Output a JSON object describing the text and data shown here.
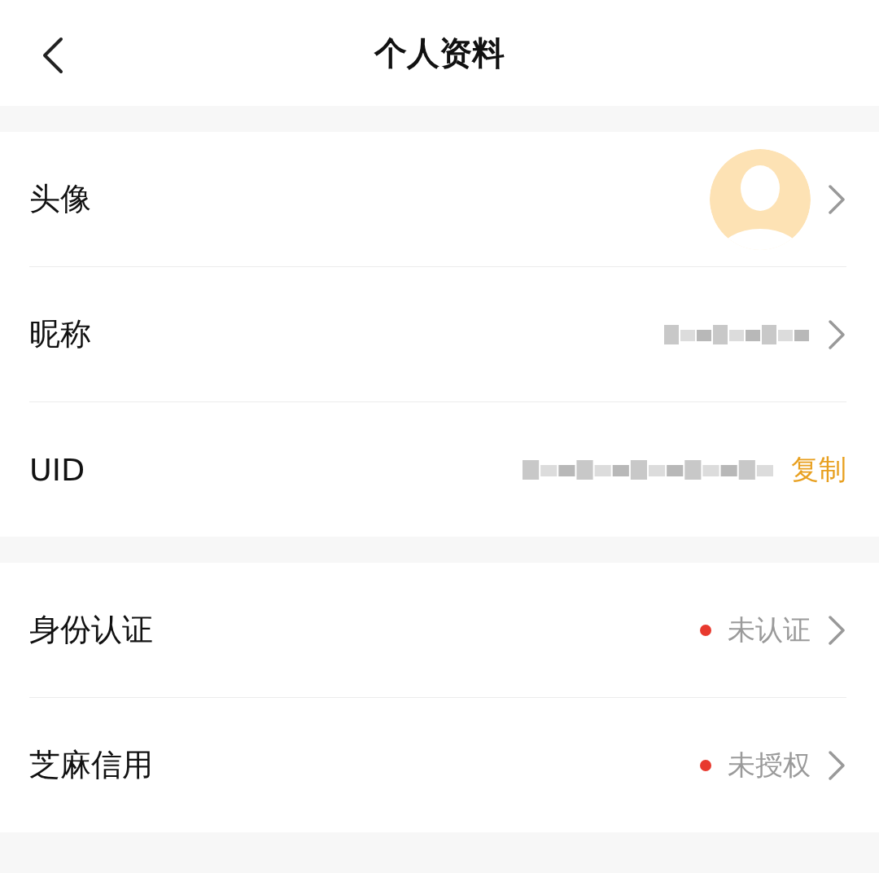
{
  "header": {
    "title": "个人资料"
  },
  "sections": [
    {
      "rows": [
        {
          "kind": "avatar",
          "label": "头像",
          "chevron": true
        },
        {
          "kind": "masked",
          "label": "昵称",
          "chevron": true
        },
        {
          "kind": "uid",
          "label": "UID",
          "action": "复制"
        }
      ]
    },
    {
      "rows": [
        {
          "kind": "status",
          "label": "身份认证",
          "status": "未认证",
          "chevron": true
        },
        {
          "kind": "status",
          "label": "芝麻信用",
          "status": "未授权",
          "chevron": true
        }
      ]
    }
  ]
}
